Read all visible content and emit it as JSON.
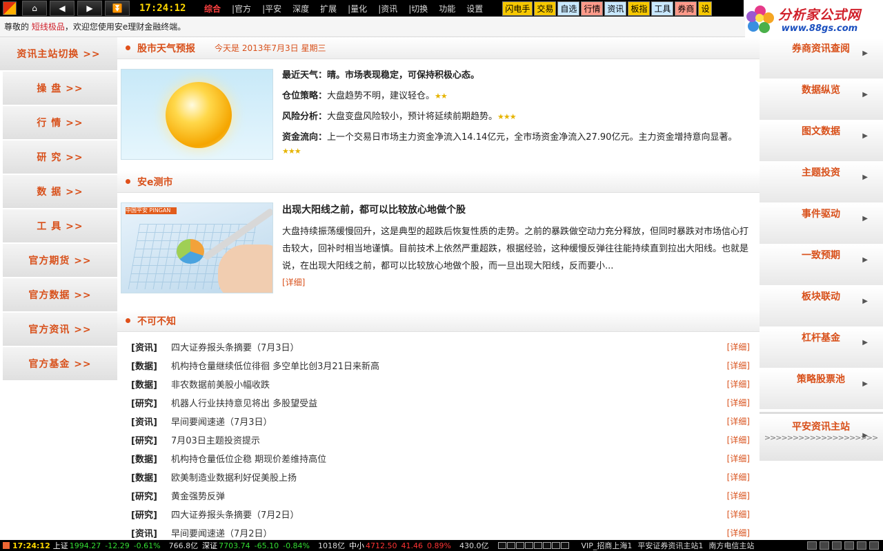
{
  "topbar": {
    "clock": "17:24:12",
    "nav_icons": [
      "home-icon",
      "left-arrow-icon",
      "right-arrow-icon",
      "double-chevron-down-icon"
    ],
    "menu": [
      "综合",
      "|官方",
      "|平安",
      "深度",
      "扩展",
      "|量化",
      "|资讯",
      "|切换",
      "功能",
      "设置"
    ],
    "active_menu": "综合",
    "quick": [
      {
        "label": "闪电手",
        "bg": "#f7c800"
      },
      {
        "label": "交易",
        "bg": "#f7c800"
      },
      {
        "label": "自选",
        "bg": "#c8e8ff"
      },
      {
        "label": "行情",
        "bg": "#ff9a8a"
      },
      {
        "label": "资讯",
        "bg": "#c8e8ff"
      },
      {
        "label": "板指",
        "bg": "#f7c800"
      },
      {
        "label": "工具",
        "bg": "#c8e8ff"
      },
      {
        "label": "券商",
        "bg": "#ff9a8a"
      },
      {
        "label": "设",
        "bg": "#f7c800"
      }
    ]
  },
  "brand": {
    "name": "分析家公式网",
    "url": "www.88gs.com"
  },
  "welcome": {
    "prefix": "尊敬的 ",
    "user": "短线极品",
    "suffix": "，欢迎您使用安e理财金融终端。"
  },
  "leftnav": [
    "资讯主站切换 >>",
    "操 盘 >>",
    "行 情 >>",
    "研 究 >>",
    "数 据 >>",
    "工 具 >>",
    "官方期货 >>",
    "官方数据 >>",
    "官方资讯 >>",
    "官方基金 >>"
  ],
  "rightnav": {
    "items": [
      "券商资讯查阅",
      "数据纵览",
      "图文数据",
      "主题投资",
      "事件驱动",
      "一致预期",
      "板块联动",
      "杠杆基金",
      "策略股票池"
    ],
    "site": {
      "label": "平安资讯主站",
      "chevrons": ">>>>>>>>>>>>>>>>>>>>"
    }
  },
  "weather": {
    "title": "股市天气预报",
    "date": "今天是 2013年7月3日 星期三",
    "latest": "最近天气：晴。市场表现稳定，可保持积极心态。",
    "position_label": "仓位策略：",
    "position_text": "大盘趋势不明，建议轻仓。",
    "position_stars": "★★",
    "risk_label": "风险分析：",
    "risk_text": "大盘变盘风险较小，预计将延续前期趋势。",
    "risk_stars": "★★★",
    "flow_label": "资金流向：",
    "flow_text": "上一个交易日市场主力资金净流入14.14亿元，全市场资金净流入27.90亿元。主力资金增持意向显著。",
    "flow_stars": "★★★"
  },
  "ece": {
    "title": "安e测市",
    "image_brand": "中国平安 PINGAN",
    "headline": "出现大阳线之前，都可以比较放心地做个股",
    "body": "大盘持续振荡缓慢回升，这是典型的超跌后恢复性质的走势。之前的暴跌做空动力充分释放，但同时暴跌对市场信心打击较大，回补时相当地谨慎。目前技术上依然严重超跌，根据经验，这种缓慢反弹往往能持续直到拉出大阳线。也就是说，在出现大阳线之前，都可以比较放心地做个股，而一旦出现大阳线，反而要小...",
    "more": "[详细]"
  },
  "must_know": {
    "title": "不可不知",
    "detail_label": "[详细]",
    "rows": [
      {
        "tag": "[资讯]",
        "title": "四大证券报头条摘要（7月3日）"
      },
      {
        "tag": "[数据]",
        "title": "机构持仓量继续低位徘徊 多空单比创3月21日来新高"
      },
      {
        "tag": "[数据]",
        "title": "非农数据前美股小幅收跌"
      },
      {
        "tag": "[研究]",
        "title": "机器人行业扶持意见将出 多股望受益"
      },
      {
        "tag": "[资讯]",
        "title": "早间要闻速递（7月3日）"
      },
      {
        "tag": "[研究]",
        "title": "7月03日主题投资提示"
      },
      {
        "tag": "[数据]",
        "title": "机构持仓量低位企稳 期现价差维持高位"
      },
      {
        "tag": "[数据]",
        "title": "欧美制造业数据利好促美股上扬"
      },
      {
        "tag": "[研究]",
        "title": "黄金强势反弹"
      },
      {
        "tag": "[研究]",
        "title": "四大证券报头条摘要（7月2日）"
      },
      {
        "tag": "[资讯]",
        "title": "早间要闻速递（7月2日）"
      }
    ]
  },
  "status": {
    "clock": "17:24:12",
    "sh_name": "上证",
    "sh_price": "1994.27",
    "sh_chg": "-12.29",
    "sh_pct": "-0.61%",
    "sh_vol": "766.8亿",
    "sz_name": "深证",
    "sz_price": "7703.74",
    "sz_chg": "-65.10",
    "sz_pct": "-0.84%",
    "sz_vol": "1018亿",
    "zx_name": "中小",
    "zx_price": "4712.50",
    "zx_chg": "41.46",
    "zx_pct": "0.89%",
    "zx_vol": "430.0亿",
    "server": "VIP_招商上海1",
    "site1": "平安证券资讯主站1",
    "site2": "南方电信主站"
  }
}
